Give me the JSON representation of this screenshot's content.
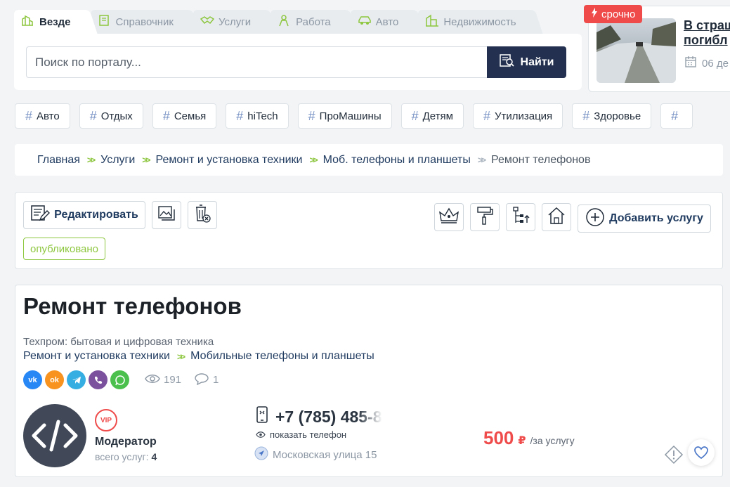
{
  "search": {
    "tabs": [
      {
        "label": "Везде",
        "icon": "buildings-icon"
      },
      {
        "label": "Справочник",
        "icon": "book-icon"
      },
      {
        "label": "Услуги",
        "icon": "handshake-icon"
      },
      {
        "label": "Работа",
        "icon": "worker-icon"
      },
      {
        "label": "Авто",
        "icon": "car-icon"
      },
      {
        "label": "Недвижимость",
        "icon": "building-icon"
      }
    ],
    "placeholder": "Поиск по порталу...",
    "button_label": "Найти"
  },
  "news": {
    "badge": "срочно",
    "title_line1": "В страш",
    "title_line2": "погибл",
    "date": "06 де"
  },
  "tags": [
    "Авто",
    "Отдых",
    "Семья",
    "hiTech",
    "ПроМашины",
    "Детям",
    "Утилизация",
    "Здоровье",
    ""
  ],
  "breadcrumb": {
    "items": [
      "Главная",
      "Услуги",
      "Ремонт и установка техники",
      "Моб. телефоны и планшеты"
    ],
    "current": "Ремонт телефонов"
  },
  "toolbar": {
    "edit_label": "Редактировать",
    "add_label": "Добавить услугу",
    "status": "опубликовано"
  },
  "listing": {
    "title": "Ремонт телефонов",
    "company": "Техпром: бытовая и цифровая техника",
    "category1": "Ремонт и установка техники",
    "category2": "Мобильные телефоны и планшеты",
    "views": "191",
    "comments": "1",
    "vip": "VIP",
    "author": "Модератор",
    "count_label": "всего услуг:",
    "count_value": "4",
    "phone_visible": "+7 (785) 48",
    "phone_faded": "5-8",
    "show_phone": "показать телефон",
    "address": "Московская улица 15",
    "price": "500",
    "currency": "₽",
    "price_unit": "/за услугу"
  },
  "colors": {
    "accent_green": "#8dc63f",
    "navy": "#23304f",
    "urgent_red": "#ef4b4b",
    "vk": "#2787f5",
    "ok": "#f7931e",
    "telegram": "#37aee2",
    "viber": "#7b519d",
    "whatsapp": "#4cc04c"
  }
}
